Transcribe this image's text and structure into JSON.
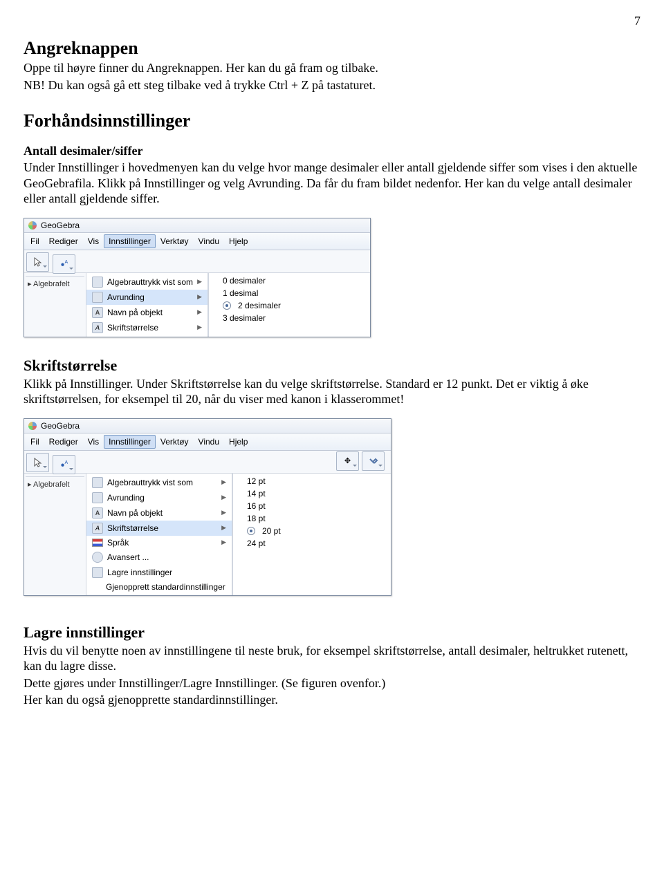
{
  "page_number": "7",
  "section1": {
    "title": "Angreknappen",
    "p1a": "Oppe til høyre finner du Angreknappen. Her kan du gå fram og tilbake.",
    "p1b": "NB! Du kan også gå ett steg tilbake ved å trykke Ctrl + Z på tastaturet."
  },
  "section2": {
    "title": "Forhåndsinnstillinger",
    "sub1_title": "Antall desimaler/siffer",
    "sub1_text": "Under Innstillinger i hovedmenyen kan du velge hvor mange desimaler eller antall gjeldende siffer som vises i den aktuelle GeoGebrafila. Klikk på Innstillinger og velg Avrunding. Da får du fram bildet nedenfor. Her kan du velge antall desimaler eller antall gjeldende siffer."
  },
  "screenshot1": {
    "app_title": "GeoGebra",
    "menu": [
      "Fil",
      "Rediger",
      "Vis",
      "Innstillinger",
      "Verktøy",
      "Vindu",
      "Hjelp"
    ],
    "menu_selected": "Innstillinger",
    "left_label": "Algebrafelt",
    "drop_items": [
      {
        "label": "Algebrauttrykk vist som",
        "arrow": true
      },
      {
        "label": "Avrunding",
        "arrow": true,
        "hover": true
      },
      {
        "label": "Navn på objekt",
        "arrow": true
      },
      {
        "label": "Skriftstørrelse",
        "arrow": true
      }
    ],
    "submenu": [
      {
        "label": "0 desimaler"
      },
      {
        "label": "1 desimal"
      },
      {
        "label": "2 desimaler",
        "selected": true
      },
      {
        "label": "3 desimaler"
      }
    ]
  },
  "section3": {
    "title": "Skriftstørrelse",
    "text": "Klikk på Innstillinger. Under Skriftstørrelse  kan du velge skriftstørrelse. Standard er 12 punkt. Det er viktig å øke skriftstørrelsen, for eksempel til 20, når du viser med kanon i klasserommet!"
  },
  "screenshot2": {
    "app_title": "GeoGebra",
    "menu": [
      "Fil",
      "Rediger",
      "Vis",
      "Innstillinger",
      "Verktøy",
      "Vindu",
      "Hjelp"
    ],
    "menu_selected": "Innstillinger",
    "left_label": "Algebrafelt",
    "drop_items": [
      {
        "label": "Algebrauttrykk vist som",
        "arrow": true
      },
      {
        "label": "Avrunding",
        "arrow": true
      },
      {
        "label": "Navn på objekt",
        "arrow": true
      },
      {
        "label": "Skriftstørrelse",
        "arrow": true,
        "hover": true
      },
      {
        "label": "Språk",
        "arrow": true,
        "flag": true
      },
      {
        "label": "Avansert ...",
        "arrow": false
      },
      {
        "label": "Lagre innstillinger",
        "arrow": false
      },
      {
        "label": "Gjenopprett standardinnstillinger",
        "arrow": false
      }
    ],
    "submenu": [
      {
        "label": "12 pt"
      },
      {
        "label": "14 pt"
      },
      {
        "label": "16 pt"
      },
      {
        "label": "18 pt"
      },
      {
        "label": "20 pt",
        "selected": true
      },
      {
        "label": "24 pt"
      }
    ]
  },
  "section4": {
    "title": "Lagre innstillinger",
    "p1": "Hvis du vil benytte noen av innstillingene til neste bruk, for eksempel skriftstørrelse, antall desimaler, heltrukket rutenett, kan du lagre disse.",
    "p2": "Dette gjøres under Innstillinger/Lagre Innstillinger. (Se figuren ovenfor.)",
    "p3": "Her kan du også gjenopprette standardinnstillinger."
  }
}
